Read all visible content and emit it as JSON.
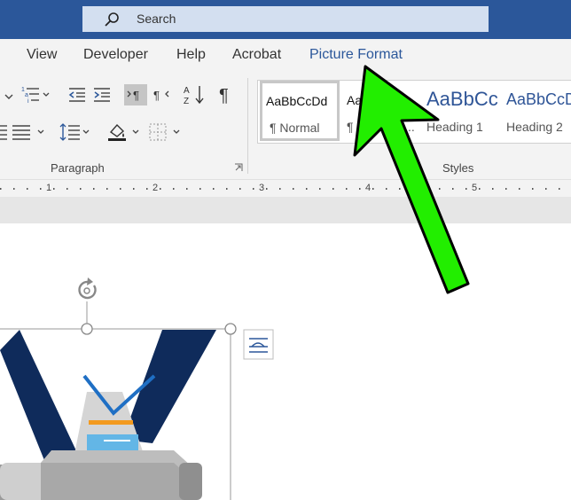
{
  "titlebar": {
    "search_label": "Search"
  },
  "tabs": [
    {
      "label": "View"
    },
    {
      "label": "Developer"
    },
    {
      "label": "Help"
    },
    {
      "label": "Acrobat"
    },
    {
      "label": "Picture Format"
    }
  ],
  "paragraph_group": {
    "label": "Paragraph"
  },
  "styles_group": {
    "label": "Styles",
    "items": [
      {
        "preview": "AaBbCcDd",
        "name": "¶ Normal"
      },
      {
        "preview": "AaBbCcDd",
        "name": "¶ No Spac..."
      },
      {
        "preview": "AaBbCc",
        "name": "Heading 1"
      },
      {
        "preview": "AaBbCcD",
        "name": "Heading 2"
      }
    ]
  },
  "ruler": {
    "numbers": [
      "1",
      "2",
      "3",
      "4",
      "5"
    ]
  },
  "colors": {
    "title_bar": "#2b579a",
    "active_tab": "#2b579a",
    "arrow": "#22ee00",
    "heading_blue": "#2f5597"
  },
  "icons": [
    "search-icon",
    "pointing-arrow-icon",
    "rotate-handle-icon",
    "layout-options-icon"
  ]
}
